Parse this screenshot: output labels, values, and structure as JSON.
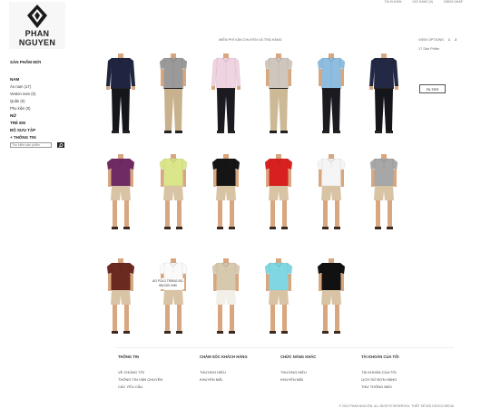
{
  "topbar": {
    "account": "TÀI KHOẢN",
    "cart": "GIỎ HÀNG (0)",
    "login": "ĐĂNG NHẬP"
  },
  "brand": {
    "name": "PHAN NGUYEN"
  },
  "sidebar": {
    "new_products": "SẢN PHẨM MỚI",
    "nam": "NAM",
    "items": [
      {
        "label": "Áo nam (17)"
      },
      {
        "label": "Veston nam (0)"
      },
      {
        "label": "Quần (0)"
      },
      {
        "label": "Phụ kiện (0)"
      }
    ],
    "nu": "NỮ",
    "tre_em": "TRẺ EM",
    "collection": "BỘ SƯU TẬP",
    "info": "+ THÔNG TIN",
    "search_placeholder": "Tìm kiếm sản phẩm"
  },
  "header": {
    "shipping": "MIỄN PHÍ VẬN CHUYỂN VÀ TRẢ HÀNG",
    "view_options": "VIEW OPTIONS",
    "view_opt_1": "1",
    "view_opt_2": "2",
    "count": "17 Sản Phẩm",
    "filter": "FILTER"
  },
  "products": [
    {
      "shirt": "#1f2540",
      "pants": "#15151c",
      "sleeve": "long"
    },
    {
      "shirt": "#9a9a9a",
      "pants": "#c8b18d",
      "sleeve": "short"
    },
    {
      "shirt": "#f0d3e0",
      "pants": "#1a1a20",
      "sleeve": "long"
    },
    {
      "shirt": "#cfc7bd",
      "pants": "#cdb995",
      "sleeve": "short"
    },
    {
      "shirt": "#8ebde0",
      "pants": "#1a1a20",
      "sleeve": "short"
    },
    {
      "shirt": "#232945",
      "pants": "#15151c",
      "sleeve": "long"
    },
    {
      "shirt": "#6f2b63",
      "pants": "#d8c3a5",
      "sleeve": "short"
    },
    {
      "shirt": "#dbe68a",
      "pants": "#d8c3a5",
      "sleeve": "short"
    },
    {
      "shirt": "#151515",
      "pants": "#d8c3a5",
      "sleeve": "short"
    },
    {
      "shirt": "#d8211f",
      "pants": "#d8c3a5",
      "sleeve": "short"
    },
    {
      "shirt": "#f5f5f5",
      "pants": "#d8c3a5",
      "sleeve": "short"
    },
    {
      "shirt": "#a7a7a7",
      "pants": "#d8c3a5",
      "sleeve": "short"
    },
    {
      "shirt": "#6b2a20",
      "pants": "#d8c3a5",
      "sleeve": "short"
    },
    {
      "shirt": "#fafafa",
      "pants": "#d8c3a5",
      "sleeve": "short"
    },
    {
      "shirt": "#d7c9ae",
      "pants": "#f2efe9",
      "sleeve": "short"
    },
    {
      "shirt": "#80d7e3",
      "pants": "#d8c3a5",
      "sleeve": "short"
    },
    {
      "shirt": "#111111",
      "pants": "#d8c3a5",
      "sleeve": "short"
    }
  ],
  "tooltip": {
    "name": "ÁO POLO TRẮNG 001",
    "price": "550.000 VNĐ"
  },
  "footer": {
    "col1": {
      "title": "THÔNG TIN",
      "links": [
        "VỀ CHÚNG TÔI",
        "THÔNG TIN VẬN CHUYỂN",
        "CÁC YÊU CẦU"
      ]
    },
    "col2": {
      "title": "CHĂM SÓC KHÁCH HÀNG",
      "links": [
        "THƯƠNG HIỆU",
        "KHUYẾN MÃI"
      ]
    },
    "col3": {
      "title": "CHỨC NĂNG KHÁC",
      "links": [
        "THƯƠNG HIỆU",
        "KHUYẾN MÃI"
      ]
    },
    "col4": {
      "title": "TÀI KHOẢN CỦA TÔI",
      "links": [
        "TÀI KHOẢN CỦA TÔI",
        "LỊCH SỬ ĐƠN HÀNG",
        "THƯ THÔNG BÁO"
      ]
    },
    "copyright": "© 2013 PHAN NGUYEN. ALL RIGHTS RESERVED. THIẾT KẾ BỞI DECKO MEDIA"
  }
}
